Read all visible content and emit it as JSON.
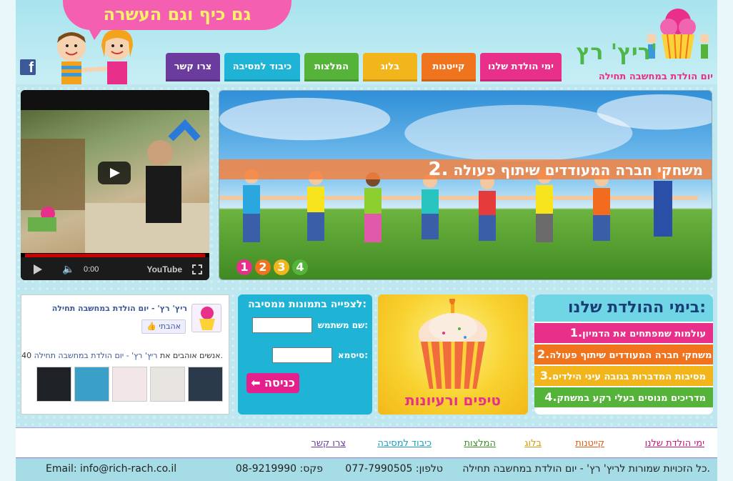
{
  "header": {
    "slogan": "גם כיף וגם העשרה",
    "logo_title": "ריץ' רץ'",
    "logo_subtitle": "יום הולדת במחשבה תחילה",
    "facebook_icon": "facebook-icon"
  },
  "nav": [
    {
      "label": "ימי הולדת שלנו",
      "color": "#e8308b"
    },
    {
      "label": "קייטנות",
      "color": "#f0731e"
    },
    {
      "label": "בלוג",
      "color": "#f2b51c"
    },
    {
      "label": "המלצות",
      "color": "#56b33a"
    },
    {
      "label": "כיבוד למסיבה",
      "color": "#1fb4d6"
    },
    {
      "label": "צרו קשר",
      "color": "#6b3c9e"
    }
  ],
  "slider": {
    "number": "2.",
    "caption": "משחקי חברה המעודדים שיתוף פעולה",
    "dots": [
      {
        "label": "1",
        "color": "#e8308b"
      },
      {
        "label": "2",
        "color": "#f0731e"
      },
      {
        "label": "3",
        "color": "#f2b51c"
      },
      {
        "label": "4",
        "color": "#56b33a"
      }
    ]
  },
  "video": {
    "time": "0:00",
    "brand": "YouTube"
  },
  "birthday_panel": {
    "title": "בימי ההולדת שלנו:",
    "items": [
      {
        "num": "1.",
        "text": "עולמות שמפתחים את הדמיון",
        "color": "#e8308b"
      },
      {
        "num": "2.",
        "text": "משחקי חברה המעודדים שיתוף פעולה",
        "color": "#f0731e"
      },
      {
        "num": "3.",
        "text": "מסיבות המדברות בגובה עיני הילדים",
        "color": "#f2b51c"
      },
      {
        "num": "4.",
        "text": "מדריכים מנוסים בעלי רקע במשחק",
        "color": "#56b33a"
      }
    ]
  },
  "tips_panel": {
    "label": "טיפים ורעיונות"
  },
  "login_panel": {
    "title": "לצפייה בתמונות ממסיבה:",
    "username_label": "שם משתמש:",
    "password_label": "סיסמא:",
    "login_button": "כניסה"
  },
  "facebook_panel": {
    "page_name": "ריץ' רץ' - יום הולדת במחשבה תחילה",
    "like_button": "אהבתי",
    "count_prefix": "40 אנשים אוהבים את",
    "count_link": "ריץ' רץ' - יום הולדת במחשבה תחילה."
  },
  "footer": {
    "links": [
      {
        "label": "ימי הולדת שלנו",
        "color": "#c2187a"
      },
      {
        "label": "קייטנות",
        "color": "#d9601a"
      },
      {
        "label": "בלוג",
        "color": "#d69a10"
      },
      {
        "label": "המלצות",
        "color": "#3f8f2a"
      },
      {
        "label": "כיבוד למסיבה",
        "color": "#1a9ec0"
      },
      {
        "label": "צרו קשר",
        "color": "#6b3c9e"
      }
    ],
    "copyright": "כל הזכויות שמורות לריץ' רץ' - יום הולדת במחשבה תחילה.",
    "phone": "טלפון: 077-7990505",
    "fax": "פקס: 08-9219990",
    "email": "Email: info@rich-rach.co.il"
  }
}
